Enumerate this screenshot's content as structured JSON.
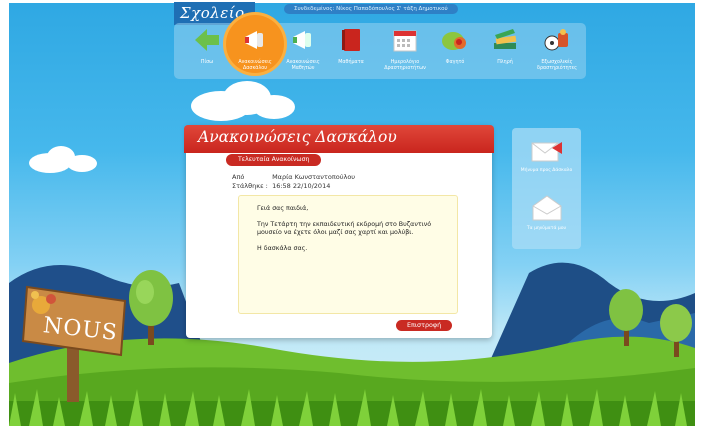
{
  "app": {
    "title": "Σχολείο",
    "login_info": "Συνδεδεμένος: Νίκος Παπαδόπουλος Σ' τάξη Δημοτικού"
  },
  "nav": {
    "items": [
      {
        "label": "Πίσω",
        "icon": "back-arrow-icon"
      },
      {
        "label": "Ανακοινώσεις Δασκάλου",
        "icon": "megaphone-icon",
        "active": true
      },
      {
        "label": "Ανακοινώσεις Μαθητών",
        "icon": "megaphone-icon"
      },
      {
        "label": "Μαθήματα",
        "icon": "book-icon"
      },
      {
        "label": "Ημερολόγιο Δραστηριοτήτων",
        "icon": "calendar-icon"
      },
      {
        "label": "Φαγητό",
        "icon": "food-icon"
      },
      {
        "label": "Πληρή",
        "icon": "books-icon"
      },
      {
        "label": "Εξωσχολικές δραστηριότητες",
        "icon": "sports-icon"
      }
    ]
  },
  "panel": {
    "title": "Ανακοινώσεις Δασκάλου",
    "latest_label": "Τελευταία Ανακοίνωση",
    "from_label": "Από",
    "from_value": "Μαρία Κωνσταντοπούλου",
    "sent_label": "Στάλθηκε :",
    "sent_value": "16:58 22/10/2014",
    "message_lines": [
      "Γειά σας παιδιά,",
      "Την Τετάρτη την εκπαιδευτική εκδρομή στο Βυζαντινό",
      "μουσείο να έχετε όλοι μαζί σας χαρτί και μολύβι.",
      "Η δασκάλα σας."
    ],
    "back_label": "Επιστροφή"
  },
  "side": {
    "send_label": "Μήνυμα προς Δάσκαλο",
    "read_label": "Τα μηνύματά μου"
  },
  "sign": {
    "text": "NOUS"
  },
  "colors": {
    "accent_red": "#c92a22",
    "nav_active": "#f7931e",
    "sky": "#2fa8e3"
  }
}
